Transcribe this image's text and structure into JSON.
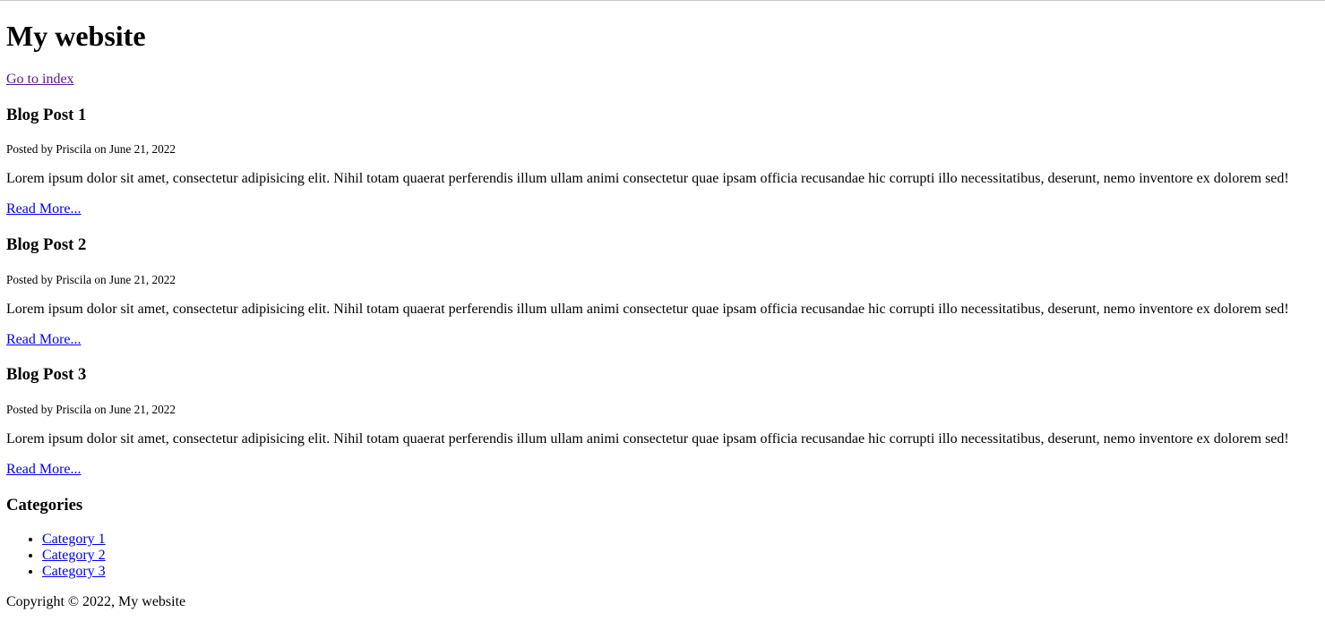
{
  "site": {
    "title": "My website",
    "index_link": "Go to index"
  },
  "posts": [
    {
      "title": "Blog Post 1",
      "meta": "Posted by Priscila on June 21, 2022",
      "body": "Lorem ipsum dolor sit amet, consectetur adipisicing elit. Nihil totam quaerat perferendis illum ullam animi consectetur quae ipsam officia recusandae hic corrupti illo necessitatibus, deserunt, nemo inventore ex dolorem sed!",
      "read_more": "Read More..."
    },
    {
      "title": "Blog Post 2",
      "meta": "Posted by Priscila on June 21, 2022",
      "body": "Lorem ipsum dolor sit amet, consectetur adipisicing elit. Nihil totam quaerat perferendis illum ullam animi consectetur quae ipsam officia recusandae hic corrupti illo necessitatibus, deserunt, nemo inventore ex dolorem sed!",
      "read_more": "Read More..."
    },
    {
      "title": "Blog Post 3",
      "meta": "Posted by Priscila on June 21, 2022",
      "body": "Lorem ipsum dolor sit amet, consectetur adipisicing elit. Nihil totam quaerat perferendis illum ullam animi consectetur quae ipsam officia recusandae hic corrupti illo necessitatibus, deserunt, nemo inventore ex dolorem sed!",
      "read_more": "Read More..."
    }
  ],
  "categories": {
    "heading": "Categories",
    "items": [
      "Category 1",
      "Category 2",
      "Category 3"
    ]
  },
  "footer": {
    "text": "Copyright © 2022, My website"
  },
  "colors": {
    "link": "#0000ee",
    "visited_link": "#551a8b",
    "text": "#000000",
    "background": "#ffffff"
  }
}
